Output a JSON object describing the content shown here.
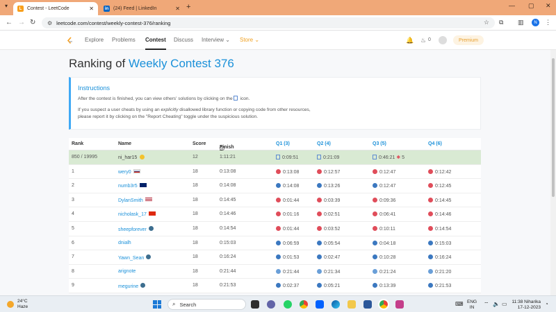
{
  "browser": {
    "tabs": [
      {
        "title": "Contest - LeetCode",
        "active": true
      },
      {
        "title": "(24) Feed | LinkedIn",
        "active": false
      }
    ],
    "url": "leetcode.com/contest/weekly-contest-376/ranking",
    "profile_initial": "N"
  },
  "nav": {
    "items": [
      "Explore",
      "Problems",
      "Contest",
      "Discuss",
      "Interview",
      "Store"
    ],
    "active": "Contest",
    "coins": "0",
    "premium_label": "Premium"
  },
  "page": {
    "title_prefix": "Ranking of",
    "title_link": "Weekly Contest 376"
  },
  "instructions": {
    "heading": "Instructions",
    "line1_a": "After the contest is finished, you can view others' solutions by clicking on the",
    "line1_b": "icon.",
    "line2_a": "If you suspect a user cheats by using an",
    "line2_em": "explicitly",
    "line2_b": "disallowed library function or copying code from other resources,",
    "line3": "please report it by clicking on the \"Report Cheating\" toggle under the suspicious solution."
  },
  "ranking": {
    "headers": {
      "rank": "Rank",
      "name": "Name",
      "score": "Score",
      "finish": "Finish Time",
      "q1": "Q1 (3)",
      "q2": "Q2 (4)",
      "q3": "Q3 (5)",
      "q4": "Q4 (6)"
    },
    "me": {
      "rank": "850 / 19995",
      "name": "ni_har15",
      "score": "12",
      "finish": "1:11:21",
      "q1": "0:09:51",
      "q2": "0:21:09",
      "q3": "0:46:21",
      "q3_penalty": "5",
      "q4": ""
    },
    "rows": [
      {
        "rank": "1",
        "name": "wery0",
        "score": "18",
        "finish": "0:13:08",
        "q1": "0:13:08",
        "q2": "0:12:57",
        "q3": "0:12:47",
        "q4": "0:12:42",
        "langs": [
          "cpp",
          "cpp",
          "cpp",
          "cpp"
        ],
        "flag": "ru"
      },
      {
        "rank": "2",
        "name": "numb3r5",
        "score": "18",
        "finish": "0:14:08",
        "q1": "0:14:08",
        "q2": "0:13:26",
        "q3": "0:12:47",
        "q4": "0:12:45",
        "langs": [
          "py",
          "py",
          "py",
          "cpp"
        ],
        "flag": "au"
      },
      {
        "rank": "3",
        "name": "DylanSmith",
        "score": "18",
        "finish": "0:14:45",
        "q1": "0:01:44",
        "q2": "0:03:39",
        "q3": "0:09:36",
        "q4": "0:14:45",
        "langs": [
          "cpp",
          "cpp",
          "cpp",
          "cpp"
        ],
        "flag": "us"
      },
      {
        "rank": "4",
        "name": "nicholask_17",
        "score": "18",
        "finish": "0:14:46",
        "q1": "0:01:16",
        "q2": "0:02:51",
        "q3": "0:06:41",
        "q4": "0:14:46",
        "langs": [
          "cpp",
          "cpp",
          "cpp",
          "cpp"
        ],
        "flag": "hk"
      },
      {
        "rank": "5",
        "name": "sheepforever",
        "score": "18",
        "finish": "0:14:54",
        "q1": "0:01:44",
        "q2": "0:03:52",
        "q3": "0:10:11",
        "q4": "0:14:54",
        "langs": [
          "cpp",
          "cpp",
          "cpp",
          "cpp"
        ],
        "flag": "globe"
      },
      {
        "rank": "6",
        "name": "dnialh",
        "score": "18",
        "finish": "0:15:03",
        "q1": "0:06:59",
        "q2": "0:05:54",
        "q3": "0:04:18",
        "q4": "0:15:03",
        "langs": [
          "py",
          "py",
          "py",
          "py"
        ],
        "flag": ""
      },
      {
        "rank": "7",
        "name": "Yawn_Sean",
        "score": "18",
        "finish": "0:16:24",
        "q1": "0:01:53",
        "q2": "0:02:47",
        "q3": "0:10:28",
        "q4": "0:16:24",
        "langs": [
          "py",
          "py",
          "py",
          "py"
        ],
        "flag": "globe"
      },
      {
        "rank": "8",
        "name": "arignote",
        "score": "18",
        "finish": "0:21:44",
        "q1": "0:21:44",
        "q2": "0:21:34",
        "q3": "0:21:24",
        "q4": "0:21:20",
        "langs": [
          "java",
          "java",
          "java",
          "java"
        ],
        "flag": ""
      },
      {
        "rank": "9",
        "name": "megurine",
        "score": "18",
        "finish": "0:21:53",
        "q1": "0:02:37",
        "q2": "0:05:21",
        "q3": "0:13:39",
        "q4": "0:21:53",
        "langs": [
          "py",
          "py",
          "py",
          "py"
        ],
        "flag": "globe"
      }
    ]
  },
  "taskbar": {
    "temp": "24°C",
    "weather": "Haze",
    "search": "Search",
    "lang1": "ENG",
    "lang2": "IN",
    "user": "Niharika",
    "time": "11:38",
    "date": "17-12-2023"
  },
  "colors": {
    "cpp": "#e04d5a",
    "py": "#3b78c0",
    "java": "#6a9fd8",
    "accent": "#1a90d9",
    "my_row": "#d9ead3"
  }
}
